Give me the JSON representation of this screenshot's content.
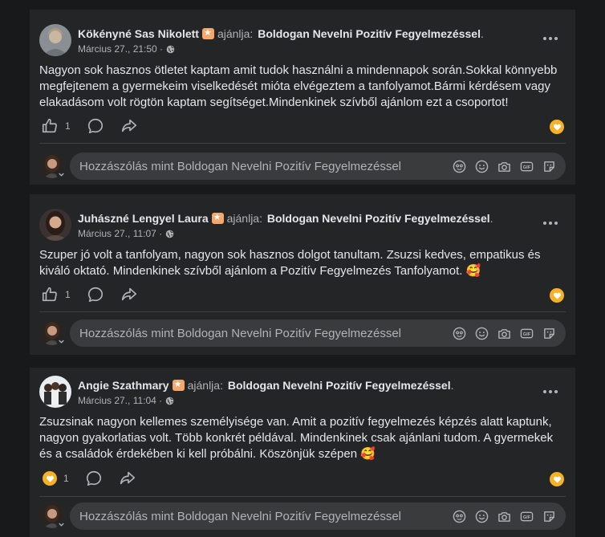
{
  "colors": {
    "background": "#18191a",
    "card": "#242526",
    "text_primary": "#e4e6eb",
    "text_secondary": "#b0b3b8",
    "badge": "#f5a86b",
    "heart_reaction": "#f7b125"
  },
  "posts": [
    {
      "author": "Kökényné Sas Nikolett",
      "recommends": "ajánlja:",
      "page": "Boldogan Nevelni Pozitív Fegyelmezéssel",
      "period": ".",
      "time": "Március 27., 21:50 ·",
      "text": "Nagyon sok hasznos ötletet kaptam amit tudok használni a mindennapok során.Sokkal könnyebb megfejtenem a gyermekeim viselkedését mióta elvégeztem a tanfolyamot.Bármi kérdésem vagy elakadásom volt rögtön kaptam segítséget.Mindenkinek szívből ajánlom ezt a csoportot!",
      "reaction_count": "1",
      "comment_placeholder": "Hozzászólás mint Boldogan Nevelni Pozitív Fegyelmezéssel"
    },
    {
      "author": "Juhászné Lengyel Laura",
      "recommends": "ajánlja:",
      "page": "Boldogan Nevelni Pozitív Fegyelmezéssel",
      "period": ".",
      "time": "Március 27., 11:07 ·",
      "text": "Szuper jó volt a tanfolyam, nagyon sok hasznos dolgot tanultam. Zsuzsi kedves, empatikus és kiváló oktató. Mindenkinek szívből ajánlom a Pozitív Fegyelmezés Tanfolyamot. 🥰",
      "reaction_count": "1",
      "comment_placeholder": "Hozzászólás mint Boldogan Nevelni Pozitív Fegyelmezéssel"
    },
    {
      "author": "Angie Szathmary",
      "recommends": "ajánlja:",
      "page": "Boldogan Nevelni Pozitív Fegyelmezéssel",
      "period": ".",
      "time": "Március 27., 11:04 ·",
      "text": "Zsuzsinak nagyon kellemes személyisége van. Amit a pozitív fegyelmezés képzés alatt kaptunk, nagyon gyakorlatias volt. Több konkrét példával. Mindenkinek csak ajánlani tudom. A gyermekek és a családok érdekében ki kell próbálni. Köszönjük szépen 🥰",
      "reaction_count": "1",
      "comment_placeholder": "Hozzászólás mint Boldogan Nevelni Pozitív Fegyelmezéssel"
    }
  ]
}
